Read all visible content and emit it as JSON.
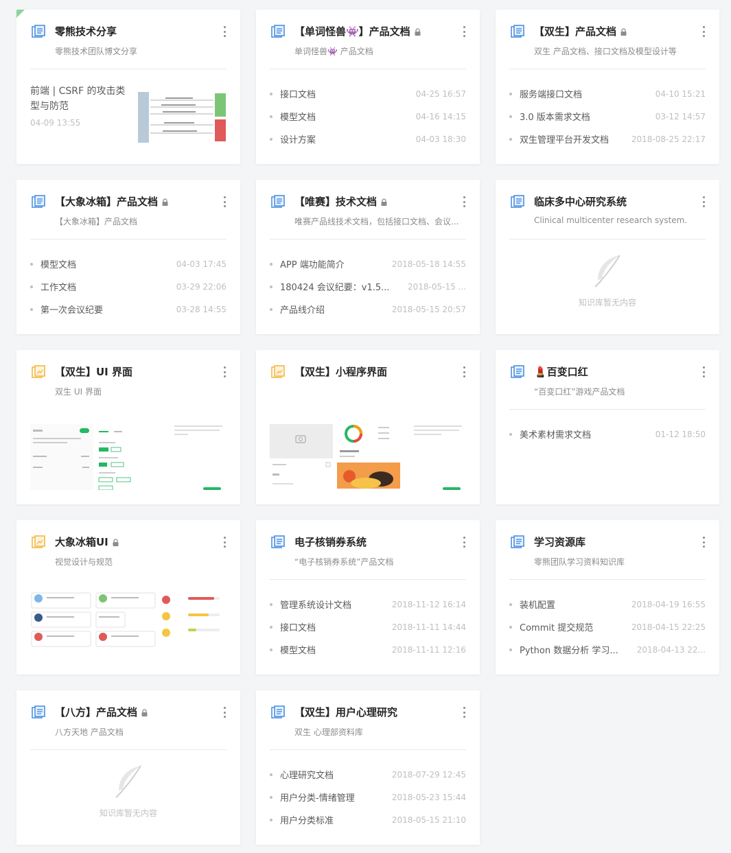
{
  "colors": {
    "accent": "#25b864",
    "doc_icon": "#4a90e2",
    "design_icon": "#f5b841",
    "empty_gray": "#d9d9d9"
  },
  "empty_text": "知识库暂无内容",
  "cards": [
    {
      "title": "零熊技术分享",
      "desc": "零熊技术团队博文分享",
      "icon": "doc-icon",
      "article": {
        "title": "前端 | CSRF 的攻击类型与防范",
        "time": "04-09 13:55"
      }
    },
    {
      "title": "【单词怪兽👾】产品文档",
      "desc": "单词怪兽👾 产品文档",
      "icon": "doc-icon",
      "locked": true,
      "docs": [
        {
          "name": "接口文档",
          "time": "04-25 16:57"
        },
        {
          "name": "模型文档",
          "time": "04-16 14:15"
        },
        {
          "name": "设计方案",
          "time": "04-03 18:30"
        }
      ]
    },
    {
      "title": "【双生】产品文档",
      "desc": "双生 产品文档、接口文档及模型设计等",
      "icon": "doc-icon",
      "locked": true,
      "docs": [
        {
          "name": "服务端接口文档",
          "time": "04-10 15:21"
        },
        {
          "name": "3.0 版本需求文档",
          "time": "03-12 14:57"
        },
        {
          "name": "双生管理平台开发文档",
          "time": "2018-08-25 22:17"
        }
      ]
    },
    {
      "title": "【大象冰箱】产品文档",
      "desc": "【大象冰箱】产品文档",
      "icon": "doc-icon",
      "locked": true,
      "docs": [
        {
          "name": "模型文档",
          "time": "04-03 17:45"
        },
        {
          "name": "工作文档",
          "time": "03-29 22:06"
        },
        {
          "name": "第一次会议纪要",
          "time": "03-28 14:55"
        }
      ]
    },
    {
      "title": "【唯赛】技术文档",
      "desc": "唯赛产品线技术文档，包括接口文档、会议...",
      "icon": "doc-icon",
      "locked": true,
      "docs": [
        {
          "name": "APP 端功能简介",
          "time": "2018-05-18 14:55"
        },
        {
          "name": "180424 会议纪要：v1.5...",
          "time": "2018-05-15 ..."
        },
        {
          "name": "产品线介绍",
          "time": "2018-05-15 20:57"
        }
      ]
    },
    {
      "title": "临床多中心研究系统",
      "desc": "Clinical multicenter research system.",
      "icon": "doc-icon",
      "empty": true
    },
    {
      "title": "【双生】UI 界面",
      "desc": "双生 UI 界面",
      "icon": "design-icon",
      "preview": "settings"
    },
    {
      "title": "【双生】小程序界面",
      "desc": "",
      "icon": "design-icon",
      "preview": "miniapp"
    },
    {
      "title": "💄百变口红",
      "desc": "“百变口红”游戏产品文档",
      "icon": "doc-icon",
      "docs": [
        {
          "name": "美术素材需求文档",
          "time": "01-12 18:50"
        }
      ]
    },
    {
      "title": "大象冰箱UI",
      "desc": "视觉设计与规范",
      "icon": "design-icon",
      "locked": true,
      "preview": "fridge"
    },
    {
      "title": "电子核销券系统",
      "desc": "“电子核销券系统”产品文档",
      "icon": "doc-icon",
      "docs": [
        {
          "name": "管理系统设计文档",
          "time": "2018-11-12 16:14"
        },
        {
          "name": "接口文档",
          "time": "2018-11-11 14:44"
        },
        {
          "name": "模型文档",
          "time": "2018-11-11 12:16"
        }
      ]
    },
    {
      "title": "学习资源库",
      "desc": "零熊团队学习资料知识库",
      "icon": "doc-icon",
      "docs": [
        {
          "name": "装机配置",
          "time": "2018-04-19 16:55"
        },
        {
          "name": "Commit 提交规范",
          "time": "2018-04-15 22:25"
        },
        {
          "name": "Python 数据分析 学习...",
          "time": "2018-04-13 22..."
        }
      ]
    },
    {
      "title": "【八方】产品文档",
      "desc": "八方天地 产品文档",
      "icon": "doc-icon",
      "locked": true,
      "empty": true
    },
    {
      "title": "【双生】用户心理研究",
      "desc": "双生 心理部资料库",
      "icon": "doc-icon",
      "docs": [
        {
          "name": "心理研究文档",
          "time": "2018-07-29 12:45"
        },
        {
          "name": "用户分类-情绪管理",
          "time": "2018-05-23 15:44"
        },
        {
          "name": "用户分类标准",
          "time": "2018-05-15 21:10"
        }
      ]
    }
  ]
}
